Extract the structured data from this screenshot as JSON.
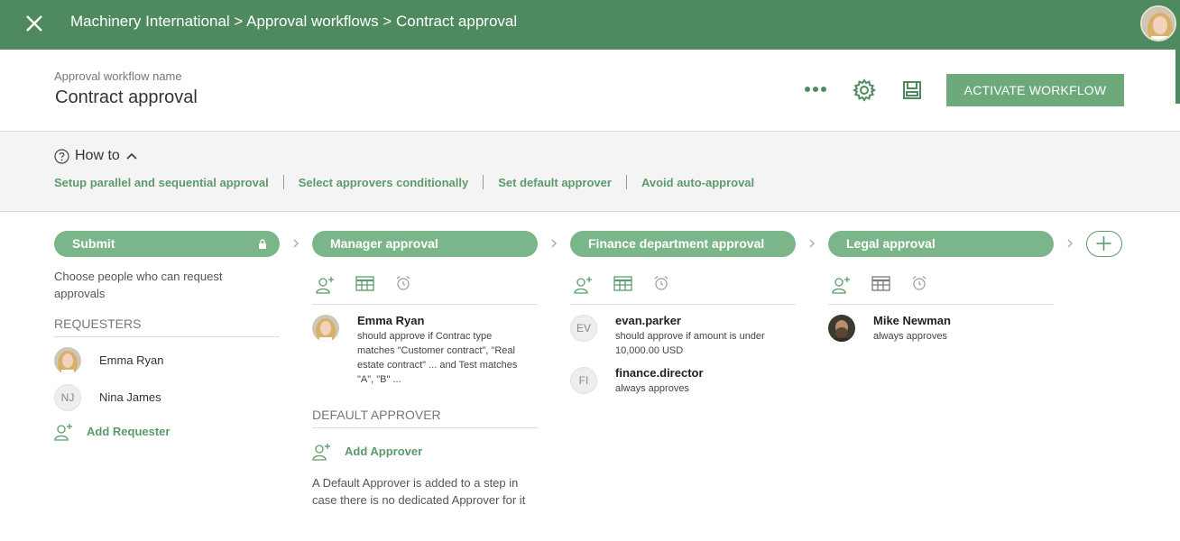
{
  "topbar": {
    "breadcrumb": "Machinery International > Approval workflows > Contract approval"
  },
  "header": {
    "label": "Approval workflow name",
    "name": "Contract approval",
    "activate_label": "ACTIVATE WORKFLOW"
  },
  "howto": {
    "title": "How to",
    "links": [
      "Setup parallel and sequential approval",
      "Select approvers conditionally",
      "Set default approver",
      "Avoid auto-approval"
    ]
  },
  "steps": {
    "submit": {
      "title": "Submit",
      "description": "Choose people who can request approvals",
      "requesters_heading": "REQUESTERS",
      "requesters": [
        {
          "name": "Emma Ryan"
        },
        {
          "name": "Nina James",
          "initials": "NJ"
        }
      ],
      "add_label": "Add Requester"
    },
    "manager": {
      "title": "Manager approval",
      "approvers": [
        {
          "name": "Emma Ryan",
          "desc": "should approve if Contrac type matches \"Customer contract\", \"Real estate contract\" ... and Test matches \"A\", \"B\" ..."
        }
      ],
      "default_heading": "DEFAULT APPROVER",
      "add_label": "Add Approver",
      "default_note": "A Default Approver is added to a step in case there is no dedicated Approver for it"
    },
    "finance": {
      "title": "Finance department approval",
      "approvers": [
        {
          "name": "evan.parker",
          "initials": "EV",
          "desc": "should approve if amount is under 10,000.00 USD"
        },
        {
          "name": "finance.director",
          "initials": "FI",
          "desc": "always approves"
        }
      ]
    },
    "legal": {
      "title": "Legal approval",
      "approvers": [
        {
          "name": "Mike Newman",
          "desc": "always approves"
        }
      ]
    }
  },
  "colors": {
    "brand": "#4f8a5e",
    "pill": "#7bb68a",
    "link": "#5d9a6b"
  }
}
